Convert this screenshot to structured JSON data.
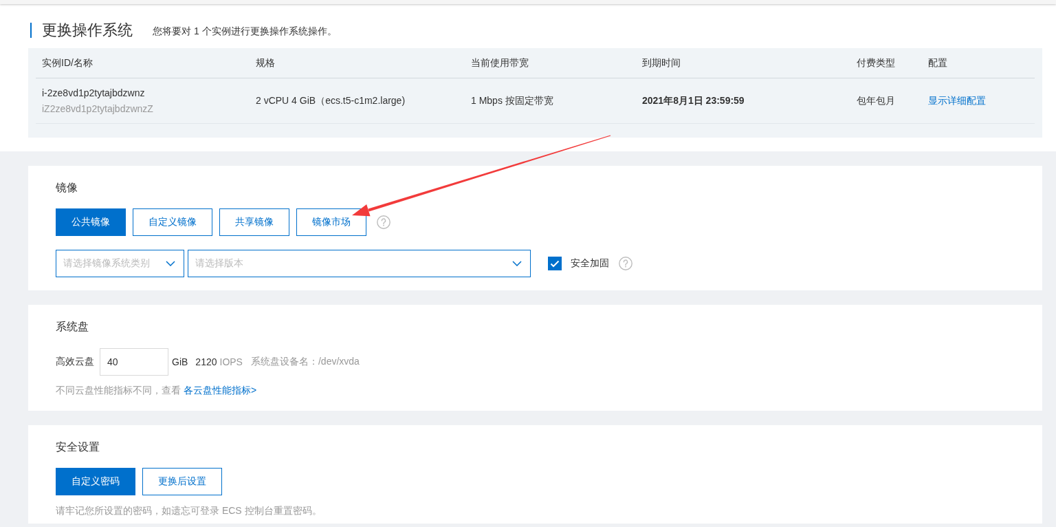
{
  "header": {
    "title": "更换操作系统",
    "subtitle": "您将要对 1 个实例进行更换操作系统操作。"
  },
  "instance_table": {
    "columns": [
      "实例ID/名称",
      "规格",
      "当前使用带宽",
      "到期时间",
      "付费类型",
      "配置"
    ],
    "rows": [
      {
        "id": "i-2ze8vd1p2tytajbdzwnz",
        "name": "iZ2ze8vd1p2tytajbdzwnzZ",
        "spec": "2 vCPU 4 GiB（ecs.t5-c1m2.large)",
        "bandwidth": "1 Mbps 按固定带宽",
        "expires": "2021年8月1日 23:59:59",
        "billing": "包年包月",
        "config_link": "显示详细配置"
      }
    ]
  },
  "image": {
    "title": "镜像",
    "tabs": [
      {
        "label": "公共镜像",
        "selected": true
      },
      {
        "label": "自定义镜像",
        "selected": false
      },
      {
        "label": "共享镜像",
        "selected": false
      },
      {
        "label": "镜像市场",
        "selected": false
      }
    ],
    "os_select": {
      "placeholder": "请选择镜像系统类别"
    },
    "version_select": {
      "placeholder": "请选择版本"
    },
    "hardening": {
      "label": "安全加固",
      "checked": true
    }
  },
  "system_disk": {
    "title": "系统盘",
    "disk_type": "高效云盘",
    "size": {
      "value": "40"
    },
    "unit": "GiB",
    "iops_value": "2120",
    "iops_unit": "IOPS",
    "device": "系统盘设备名：/dev/xvda",
    "note": "不同云盘性能指标不同，查看",
    "note_link": "各云盘性能指标>"
  },
  "security": {
    "title": "安全设置",
    "options": [
      {
        "label": "自定义密码",
        "selected": true
      },
      {
        "label": "更换后设置",
        "selected": false
      }
    ],
    "note": "请牢记您所设置的密码，如遗忘可登录 ECS 控制台重置密码。"
  }
}
